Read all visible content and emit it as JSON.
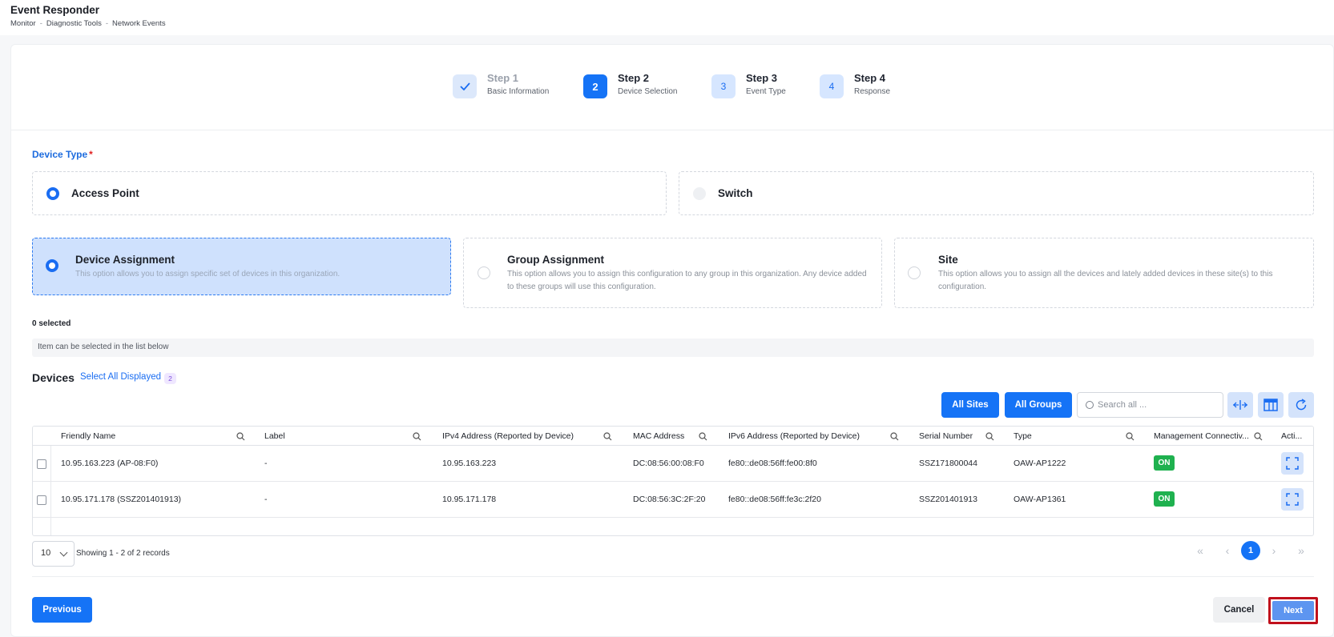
{
  "header": {
    "title": "Event Responder",
    "breadcrumb": [
      "Monitor",
      "Diagnostic Tools",
      "Network Events"
    ],
    "breadcrumb_sep": "-"
  },
  "stepper": [
    {
      "number": "✓",
      "title": "Step 1",
      "subtitle": "Basic Information",
      "state": "done"
    },
    {
      "number": "2",
      "title": "Step 2",
      "subtitle": "Device Selection",
      "state": "active"
    },
    {
      "number": "3",
      "title": "Step 3",
      "subtitle": "Event Type",
      "state": "pending"
    },
    {
      "number": "4",
      "title": "Step 4",
      "subtitle": "Response",
      "state": "pending"
    }
  ],
  "device_type": {
    "label": "Device Type",
    "required_mark": "*",
    "options": [
      {
        "label": "Access Point",
        "selected": true
      },
      {
        "label": "Switch",
        "selected": false
      }
    ]
  },
  "assignment": [
    {
      "title": "Device Assignment",
      "desc": "This option allows you to assign specific set of devices in this organization.",
      "selected": true
    },
    {
      "title": "Group Assignment",
      "desc": "This option allows you to assign this configuration to any group in this organization. Any device added to these groups will use this configuration.",
      "selected": false
    },
    {
      "title": "Site",
      "desc": "This option allows you to assign all the devices and lately added devices in these site(s) to this configuration.",
      "selected": false
    }
  ],
  "selection": {
    "count_text": "0 selected",
    "info": "Item can be selected in the list below"
  },
  "devices": {
    "title": "Devices",
    "select_all": "Select All Displayed",
    "count": "2",
    "all_sites": "All Sites",
    "all_groups": "All Groups",
    "search_placeholder": "Search all ...",
    "columns": [
      "Friendly Name",
      "Label",
      "IPv4 Address (Reported by Device)",
      "MAC Address",
      "IPv6 Address (Reported by Device)",
      "Serial Number",
      "Type",
      "Management Connectiv...",
      "Acti..."
    ],
    "rows": [
      {
        "name": "10.95.163.223 (AP-08:F0)",
        "label": "-",
        "ipv4": "10.95.163.223",
        "mac": "DC:08:56:00:08:F0",
        "ipv6": "fe80::de08:56ff:fe00:8f0",
        "serial": "SSZ171800044",
        "type": "OAW-AP1222",
        "status": "ON"
      },
      {
        "name": "10.95.171.178 (SSZ201401913)",
        "label": "-",
        "ipv4": "10.95.171.178",
        "mac": "DC:08:56:3C:2F:20",
        "ipv6": "fe80::de08:56ff:fe3c:2f20",
        "serial": "SSZ201401913",
        "type": "OAW-AP1361",
        "status": "ON"
      }
    ]
  },
  "pagination": {
    "page_size": "10",
    "records": "Showing 1 - 2 of 2 records",
    "current_page": "1"
  },
  "footer": {
    "previous": "Previous",
    "cancel": "Cancel",
    "next": "Next"
  },
  "colors": {
    "primary": "#1573f6",
    "selected_bg": "#cfe1fd",
    "on_badge": "#1fb14f",
    "highlight_border": "#c0101c"
  }
}
